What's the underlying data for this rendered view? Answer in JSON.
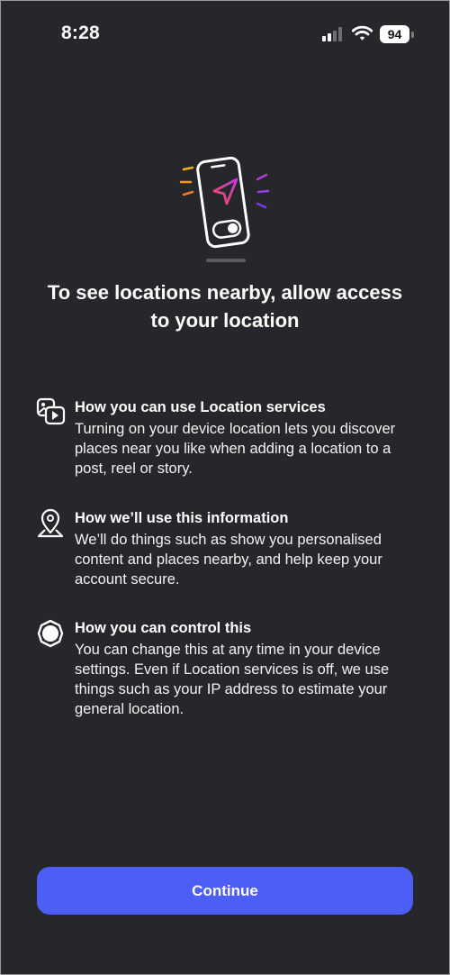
{
  "status_bar": {
    "time": "8:28",
    "battery_level": "94",
    "icons": [
      "signal-icon",
      "wifi-icon",
      "battery-icon"
    ]
  },
  "hero": {
    "icon": "phone-location-illustration",
    "ray_colors": [
      "#f5b21c",
      "#f37a22",
      "#b23bdb",
      "#7a3cf0"
    ],
    "arrow_gradient": [
      "#f24a57",
      "#c13ae0"
    ]
  },
  "headline": "To see locations nearby, allow access to your location",
  "sections": [
    {
      "icon": "media-icon",
      "title": "How you can use Location services",
      "body": "Turning on your device location lets you discover places near you like when adding a location to a post, reel or story."
    },
    {
      "icon": "map-pin-icon",
      "title": "How we’ll use this information",
      "body": "We’ll do things such as show you personalised content and places nearby, and help keep your account secure."
    },
    {
      "icon": "gear-icon",
      "title": "How you can control this",
      "body": "You can change this at any time in your device settings. Even if Location services is off, we use things such as your IP address to estimate your general location."
    }
  ],
  "continue_button": {
    "label": "Continue",
    "color": "#4d5ef6"
  },
  "colors": {
    "background": "#26272b",
    "text": "#ffffff"
  }
}
